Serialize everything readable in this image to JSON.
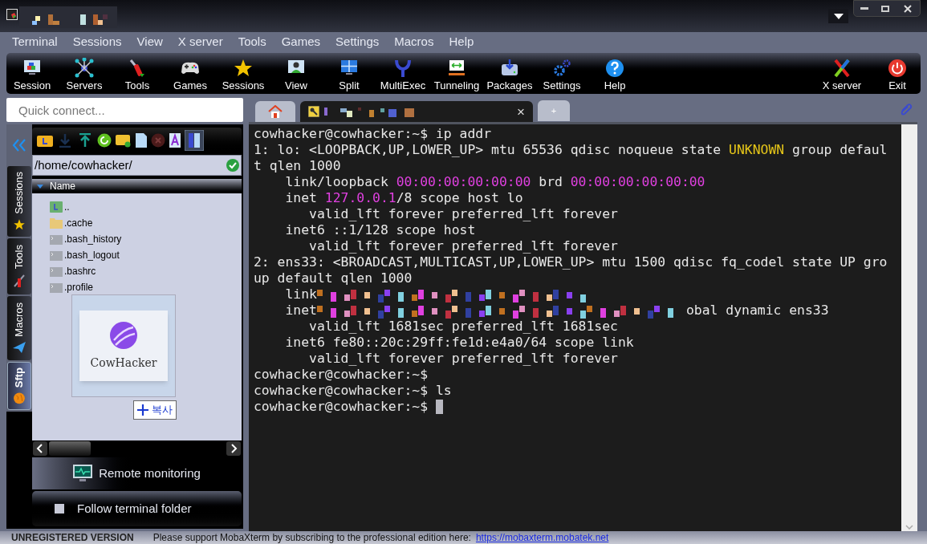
{
  "menu": [
    "Terminal",
    "Sessions",
    "View",
    "X server",
    "Tools",
    "Games",
    "Settings",
    "Macros",
    "Help"
  ],
  "toolbar": {
    "left": [
      "Session",
      "Servers",
      "Tools",
      "Games",
      "Sessions",
      "View",
      "Split",
      "MultiExec",
      "Tunneling",
      "Packages",
      "Settings",
      "Help"
    ],
    "right": [
      "X server",
      "Exit"
    ]
  },
  "quick_connect": {
    "placeholder": "Quick connect..."
  },
  "tabs": [
    {
      "kind": "home",
      "selected": false
    },
    {
      "kind": "session",
      "selected": true,
      "close": "×"
    },
    {
      "kind": "new",
      "selected": false,
      "label": "+"
    }
  ],
  "side_tabs": [
    {
      "label": "Sessions",
      "selected": false
    },
    {
      "label": "Tools",
      "selected": false
    },
    {
      "label": "Macros",
      "selected": false
    },
    {
      "label": "Sftp",
      "selected": true
    }
  ],
  "sftp": {
    "path": "/home/cowhacker/",
    "column": "Name",
    "files": [
      {
        "name": "..",
        "kind": "parent"
      },
      {
        "name": ".cache",
        "kind": "folder"
      },
      {
        "name": ".bash_history",
        "kind": "file"
      },
      {
        "name": ".bash_logout",
        "kind": "file"
      },
      {
        "name": ".bashrc",
        "kind": "file"
      },
      {
        "name": ".profile",
        "kind": "file"
      }
    ],
    "drag": {
      "label": "CowHacker",
      "tooltip": "복사"
    },
    "remote_monitoring": "Remote monitoring",
    "follow": {
      "label": "Follow terminal folder",
      "checked": false
    }
  },
  "terminal": [
    {
      "segments": [
        {
          "text": "cowhacker@cowhacker:~$ ip addr"
        }
      ]
    },
    {
      "segments": [
        {
          "text": "1: lo: <LOOPBACK,UP,LOWER_UP> mtu 65536 qdisc noqueue state "
        },
        {
          "text": "UNKNOWN",
          "color": "#e6c619"
        },
        {
          "text": " group defaul"
        }
      ]
    },
    {
      "segments": [
        {
          "text": "t qlen 1000"
        }
      ]
    },
    {
      "segments": [
        {
          "text": "    link/loopback "
        },
        {
          "text": "00:00:00:00:00:00",
          "color": "#e040e0"
        },
        {
          "text": " brd "
        },
        {
          "text": "00:00:00:00:00:00",
          "color": "#e040e0"
        }
      ]
    },
    {
      "segments": [
        {
          "text": "    inet "
        },
        {
          "text": "127.0.0.1",
          "color": "#e040e0"
        },
        {
          "text": "/8 scope host lo"
        }
      ]
    },
    {
      "segments": [
        {
          "text": "       valid_lft forever preferred_lft forever"
        }
      ]
    },
    {
      "segments": [
        {
          "text": "    inet6 ::1/128 scope host"
        }
      ]
    },
    {
      "segments": [
        {
          "text": "       valid_lft forever preferred_lft forever"
        }
      ]
    },
    {
      "segments": [
        {
          "text": "2: ens33: <BROADCAST,MULTICAST,UP,LOWER_UP> mtu 1500 qdisc fq_codel state UP gro"
        }
      ]
    },
    {
      "segments": [
        {
          "text": "up default qlen 1000"
        }
      ]
    },
    {
      "segments": [
        {
          "kind": "text",
          "text": "    link"
        },
        {
          "kind": "redacted"
        }
      ]
    },
    {
      "segments": [
        {
          "kind": "text",
          "text": "    inet"
        },
        {
          "kind": "redacted"
        },
        {
          "kind": "text",
          "text": "obal dynamic ens33"
        }
      ]
    },
    {
      "segments": [
        {
          "text": "       valid_lft 1681sec preferred_lft 1681sec"
        }
      ]
    },
    {
      "segments": [
        {
          "text": "    inet6 fe80::20c:29ff:fe1d:e4a0/64 scope link"
        }
      ]
    },
    {
      "segments": [
        {
          "text": "       valid_lft forever preferred_lft forever"
        }
      ]
    },
    {
      "segments": [
        {
          "text": "cowhacker@cowhacker:~$"
        }
      ]
    },
    {
      "segments": [
        {
          "text": "cowhacker@cowhacker:~$ ls"
        }
      ]
    },
    {
      "segments": [
        {
          "text": "cowhacker@cowhacker:~$ "
        }
      ],
      "cursor": true
    }
  ],
  "status_bar": {
    "label": "UNREGISTERED VERSION",
    "message": "Please support MobaXterm by subscribing to the professional edition here:",
    "link": "https://mobaxterm.mobatek.net"
  }
}
